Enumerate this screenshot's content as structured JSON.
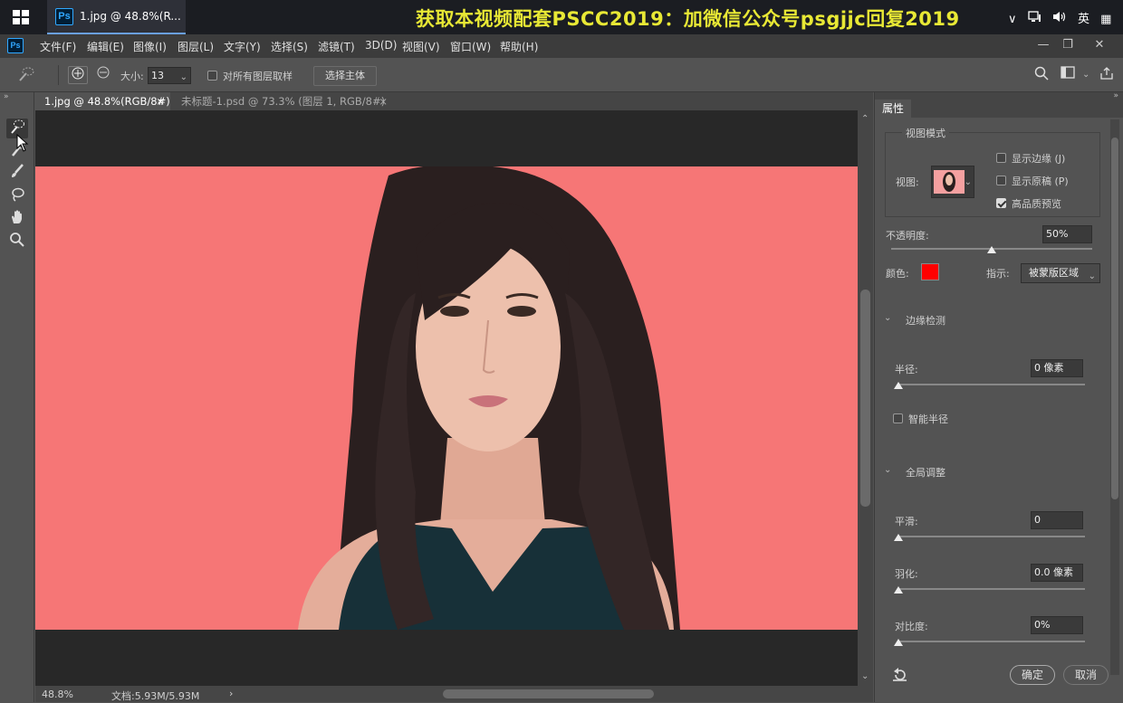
{
  "taskbar": {
    "ps_icon": "Ps",
    "task_title": "1.jpg @ 48.8%(R...",
    "promo_text": "获取本视频配套PSCC2019：加微信公众号psgjjc回复2019",
    "tray": {
      "chevron": "∨",
      "ime": "英",
      "grid": "▦"
    }
  },
  "menubar": {
    "items": [
      "文件(F)",
      "编辑(E)",
      "图像(I)",
      "图层(L)",
      "文字(Y)",
      "选择(S)",
      "滤镜(T)",
      "3D(D)",
      "视图(V)",
      "窗口(W)",
      "帮助(H)"
    ],
    "min": "—",
    "restore": "❐",
    "close": "✕"
  },
  "options": {
    "size_label": "大小:",
    "size_value": "13",
    "sample_all_label": "对所有图层取样",
    "select_subject": "选择主体"
  },
  "tabs": [
    {
      "label": "1.jpg @ 48.8%(RGB/8#)",
      "close": "×",
      "active": true
    },
    {
      "label": "未标题-1.psd @ 73.3% (图层 1, RGB/8#)",
      "close": "×",
      "active": false
    }
  ],
  "status": {
    "zoom": "48.8%",
    "doc": "文档:5.93M/5.93M",
    "arrow": "›"
  },
  "props": {
    "tab": "属性",
    "view_mode": {
      "title": "视图模式",
      "view_label": "视图:",
      "show_edge": "显示边缘 (J)",
      "show_original": "显示原稿 (P)",
      "hq_preview": "高品质预览"
    },
    "opacity_label": "不透明度:",
    "opacity_value": "50%",
    "opacity": 0.5,
    "color_label": "颜色:",
    "overlay_color": "#ff0000",
    "indicate_label": "指示:",
    "indicate_value": "被蒙版区域",
    "edge_detection": {
      "title": "边缘检测",
      "radius_label": "半径:",
      "radius_value": "0 像素",
      "smart_radius": "智能半径"
    },
    "global": {
      "title": "全局调整",
      "smooth_label": "平滑:",
      "smooth_value": "0",
      "feather_label": "羽化:",
      "feather_value": "0.0 像素",
      "contrast_label": "对比度:",
      "contrast_value": "0%"
    },
    "ok": "确定",
    "cancel": "取消"
  },
  "colors": {
    "background_fill": "#f67676",
    "accent": "#e8e835"
  }
}
